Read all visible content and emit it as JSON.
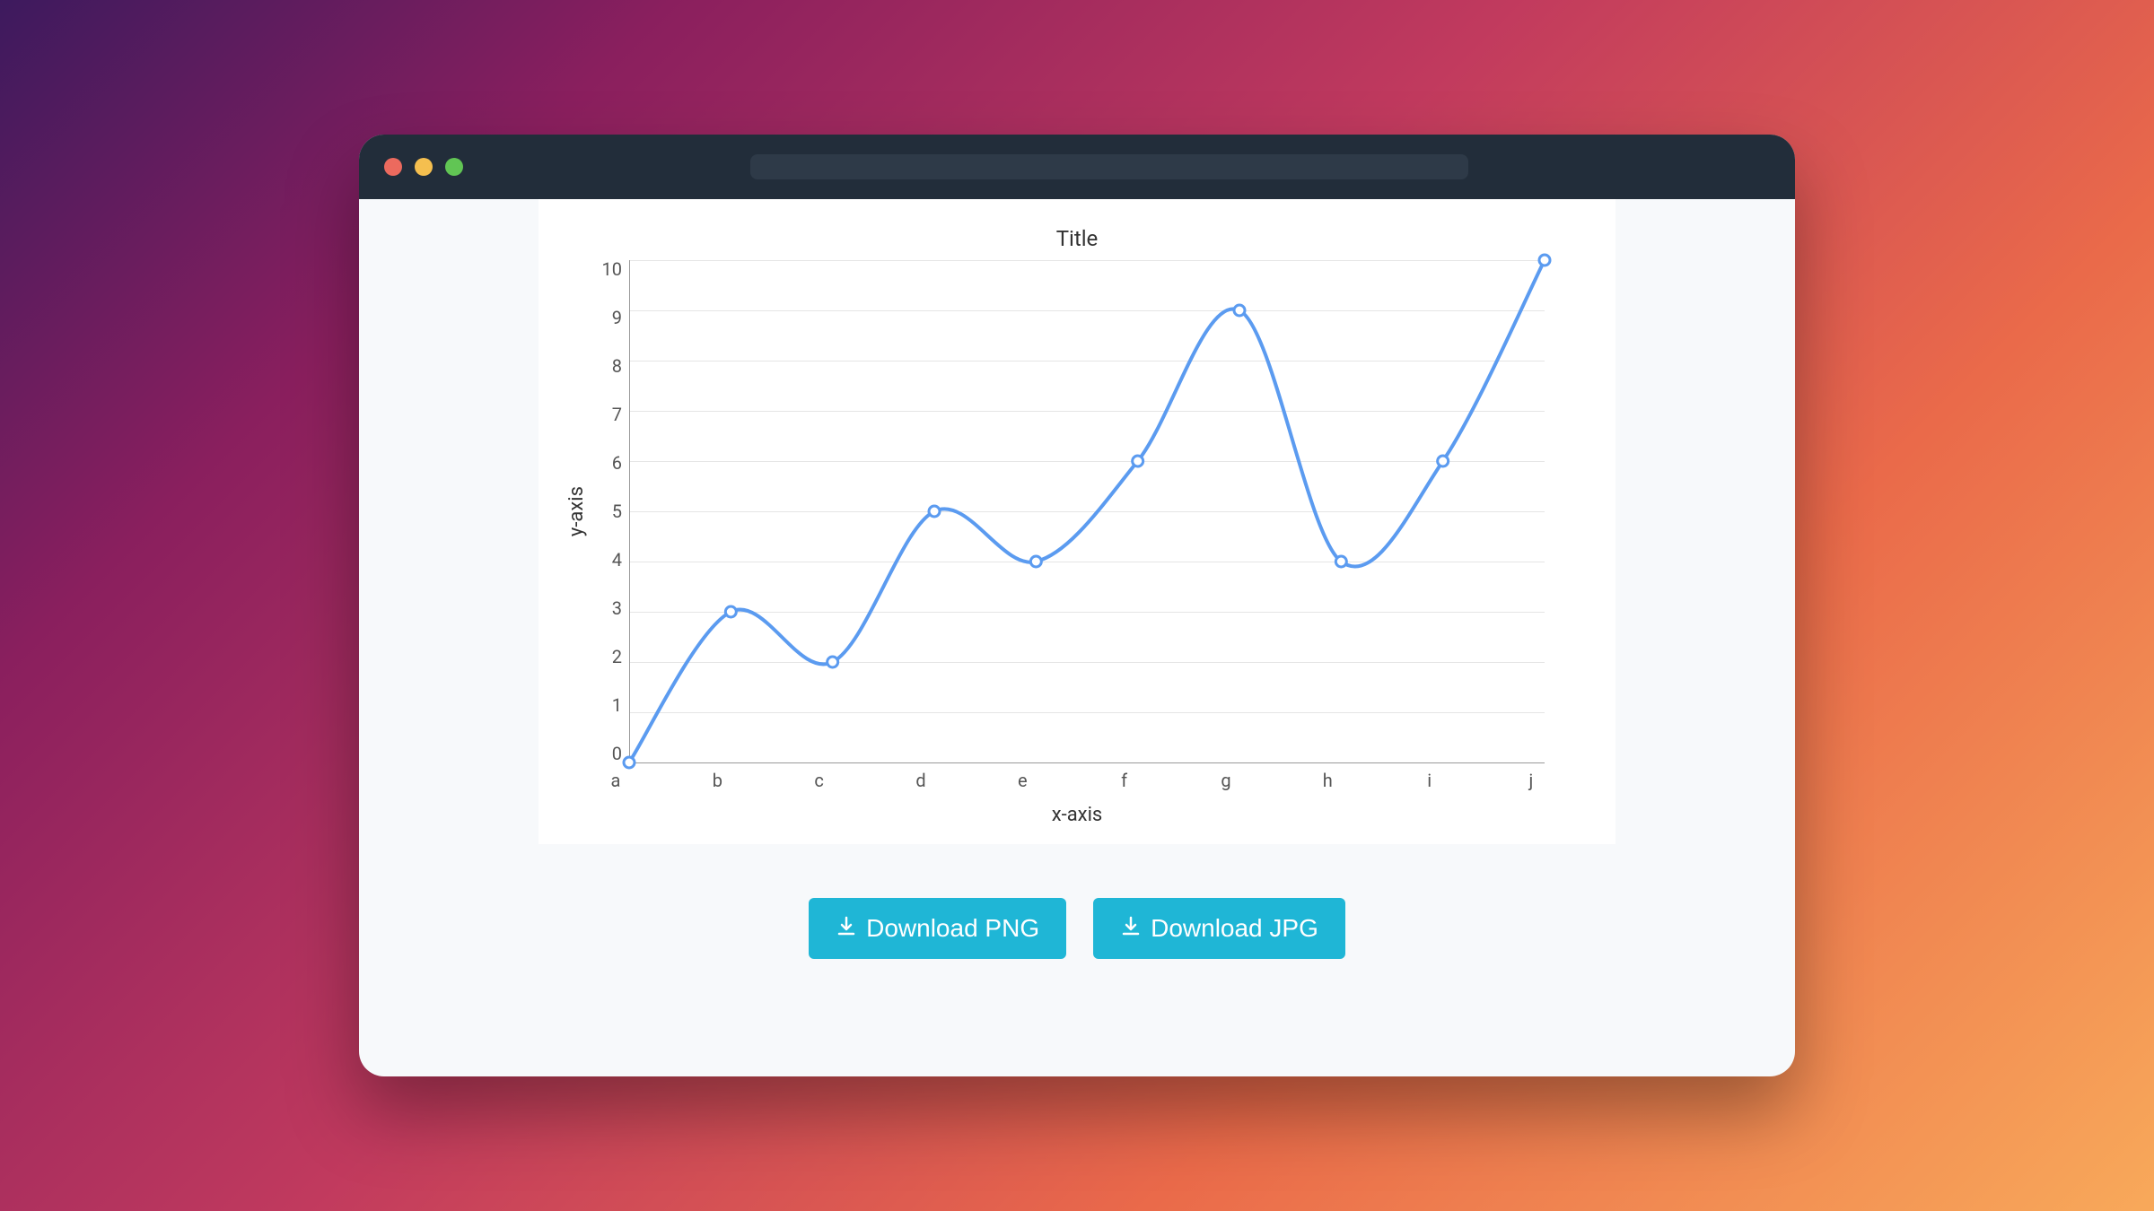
{
  "chart_data": {
    "type": "line",
    "title": "Title",
    "xlabel": "x-axis",
    "ylabel": "y-axis",
    "categories": [
      "a",
      "b",
      "c",
      "d",
      "e",
      "f",
      "g",
      "h",
      "i",
      "j"
    ],
    "values": [
      0,
      3,
      2,
      5,
      4,
      6,
      9,
      4,
      6,
      10
    ],
    "ylim": [
      0,
      10
    ],
    "y_ticks": [
      10,
      9,
      8,
      7,
      6,
      5,
      4,
      3,
      2,
      1,
      0
    ],
    "grid": true,
    "line_color": "#5b9bf0"
  },
  "buttons": {
    "download_png": "Download PNG",
    "download_jpg": "Download JPG"
  }
}
